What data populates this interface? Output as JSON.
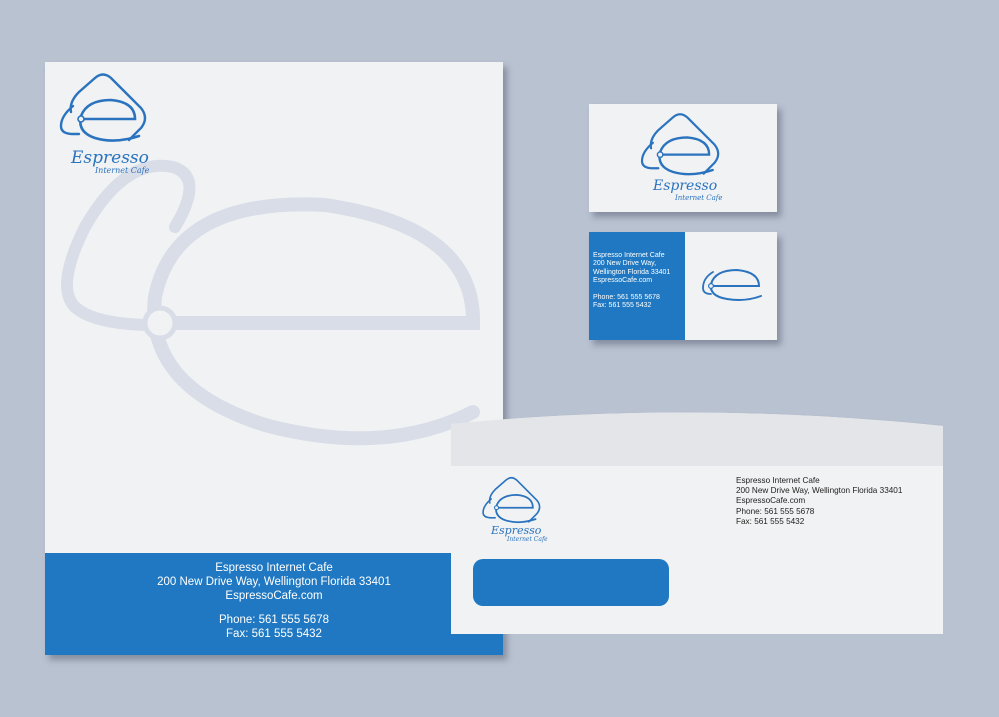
{
  "brand": {
    "name": "Espresso",
    "tagline": "Internet Cafe",
    "colors": {
      "primary": "#1f78c1",
      "watermark": "#d9dde8",
      "paper": "#f1f2f3",
      "background": "#b9c2d1"
    },
    "logo_icon": "coffee-bean-e-icon"
  },
  "letterhead": {
    "footer": {
      "company": "Espresso Internet Cafe",
      "address": "200 New Drive Way, Wellington Florida 33401",
      "website": "EspressoCafe.com",
      "phone": "Phone: 561 555 5678",
      "fax": "Fax: 561 555 5432"
    }
  },
  "business_card": {
    "back": {
      "company": "Espresso Internet Cafe",
      "address_line1": "200 New Drive Way,",
      "address_line2": "Wellington Florida 33401",
      "website": "EspressoCafe.com",
      "phone": "Phone: 561 555 5678",
      "fax": "Fax: 561 555 5432"
    }
  },
  "envelope": {
    "company": "Espresso Internet Cafe",
    "address": "200 New Drive Way, Wellington Florida 33401",
    "website": "EspressoCafe.com",
    "phone": "Phone: 561 555 5678",
    "fax": "Fax: 561 555 5432"
  }
}
